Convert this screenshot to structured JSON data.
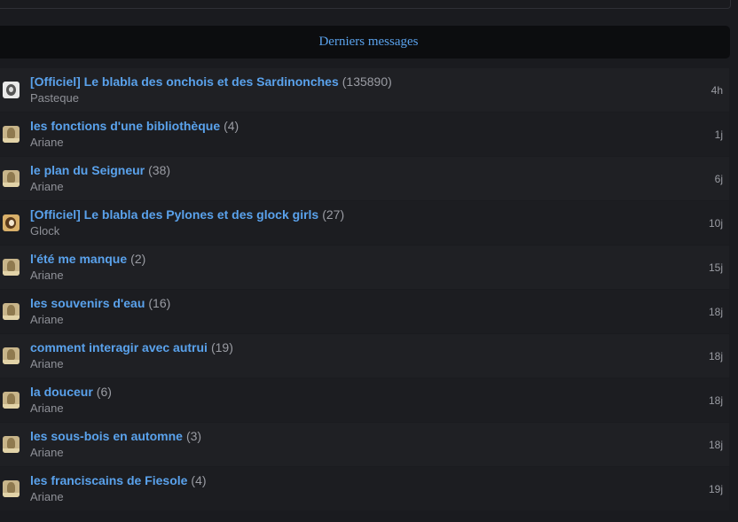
{
  "section": {
    "title": "Derniers messages"
  },
  "rows": [
    {
      "title": "[Officiel] Le blabla des onchois et des Sardinonches",
      "count": "(135890)",
      "author": "Pasteque",
      "time": "4h",
      "avatar": "gray-avatar"
    },
    {
      "title": "les fonctions d'une bibliothèque",
      "count": "(4)",
      "author": "Ariane",
      "time": "1j",
      "avatar": "tan-avatar"
    },
    {
      "title": "le plan du Seigneur",
      "count": "(38)",
      "author": "Ariane",
      "time": "6j",
      "avatar": "tan-avatar"
    },
    {
      "title": "[Officiel] Le blabla des Pylones et des glock girls",
      "count": "(27)",
      "author": "Glock",
      "time": "10j",
      "avatar": "warm-avatar"
    },
    {
      "title": "l'été me manque",
      "count": "(2)",
      "author": "Ariane",
      "time": "15j",
      "avatar": "tan-avatar"
    },
    {
      "title": "les souvenirs d'eau",
      "count": "(16)",
      "author": "Ariane",
      "time": "18j",
      "avatar": "tan-avatar"
    },
    {
      "title": "comment interagir avec autrui",
      "count": "(19)",
      "author": "Ariane",
      "time": "18j",
      "avatar": "tan-avatar"
    },
    {
      "title": "la douceur",
      "count": "(6)",
      "author": "Ariane",
      "time": "18j",
      "avatar": "tan-avatar"
    },
    {
      "title": "les sous-bois en automne",
      "count": "(3)",
      "author": "Ariane",
      "time": "18j",
      "avatar": "tan-avatar"
    },
    {
      "title": "les franciscains de Fiesole",
      "count": "(4)",
      "author": "Ariane",
      "time": "19j",
      "avatar": "tan-avatar"
    }
  ],
  "colors": {
    "background": "#1a1b1f",
    "header_background": "#0c0d0f",
    "link": "#5aa2ec",
    "muted_text": "#9a9ca3"
  }
}
